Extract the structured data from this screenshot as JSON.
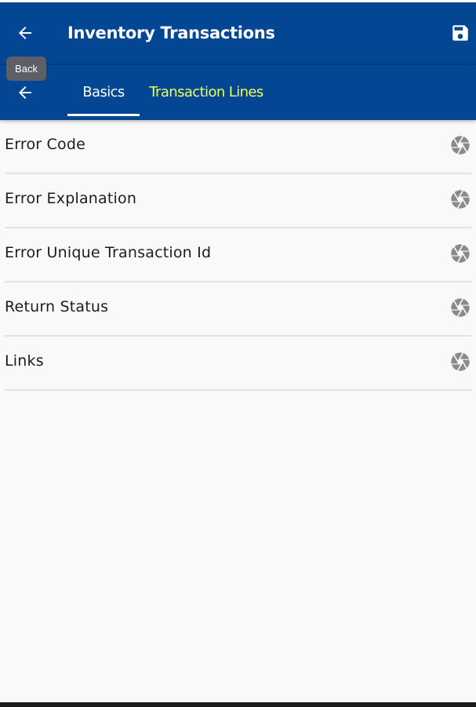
{
  "app": {
    "title": "Inventory Transactions",
    "tooltip": "Back",
    "primary_color": "#034694",
    "active_tab_color": "#ffffff",
    "inactive_tab_color": "#eeff55"
  },
  "icons": {
    "back": "arrow-left-icon",
    "save": "floppy-disk-icon",
    "row": "camera-aperture-icon"
  },
  "tabs": [
    {
      "label": "Basics",
      "active": true
    },
    {
      "label": "Transaction Lines",
      "active": false
    }
  ],
  "fields": [
    {
      "label": "Error Code"
    },
    {
      "label": "Error Explanation"
    },
    {
      "label": "Error Unique Transaction Id"
    },
    {
      "label": "Return Status"
    },
    {
      "label": "Links"
    }
  ]
}
